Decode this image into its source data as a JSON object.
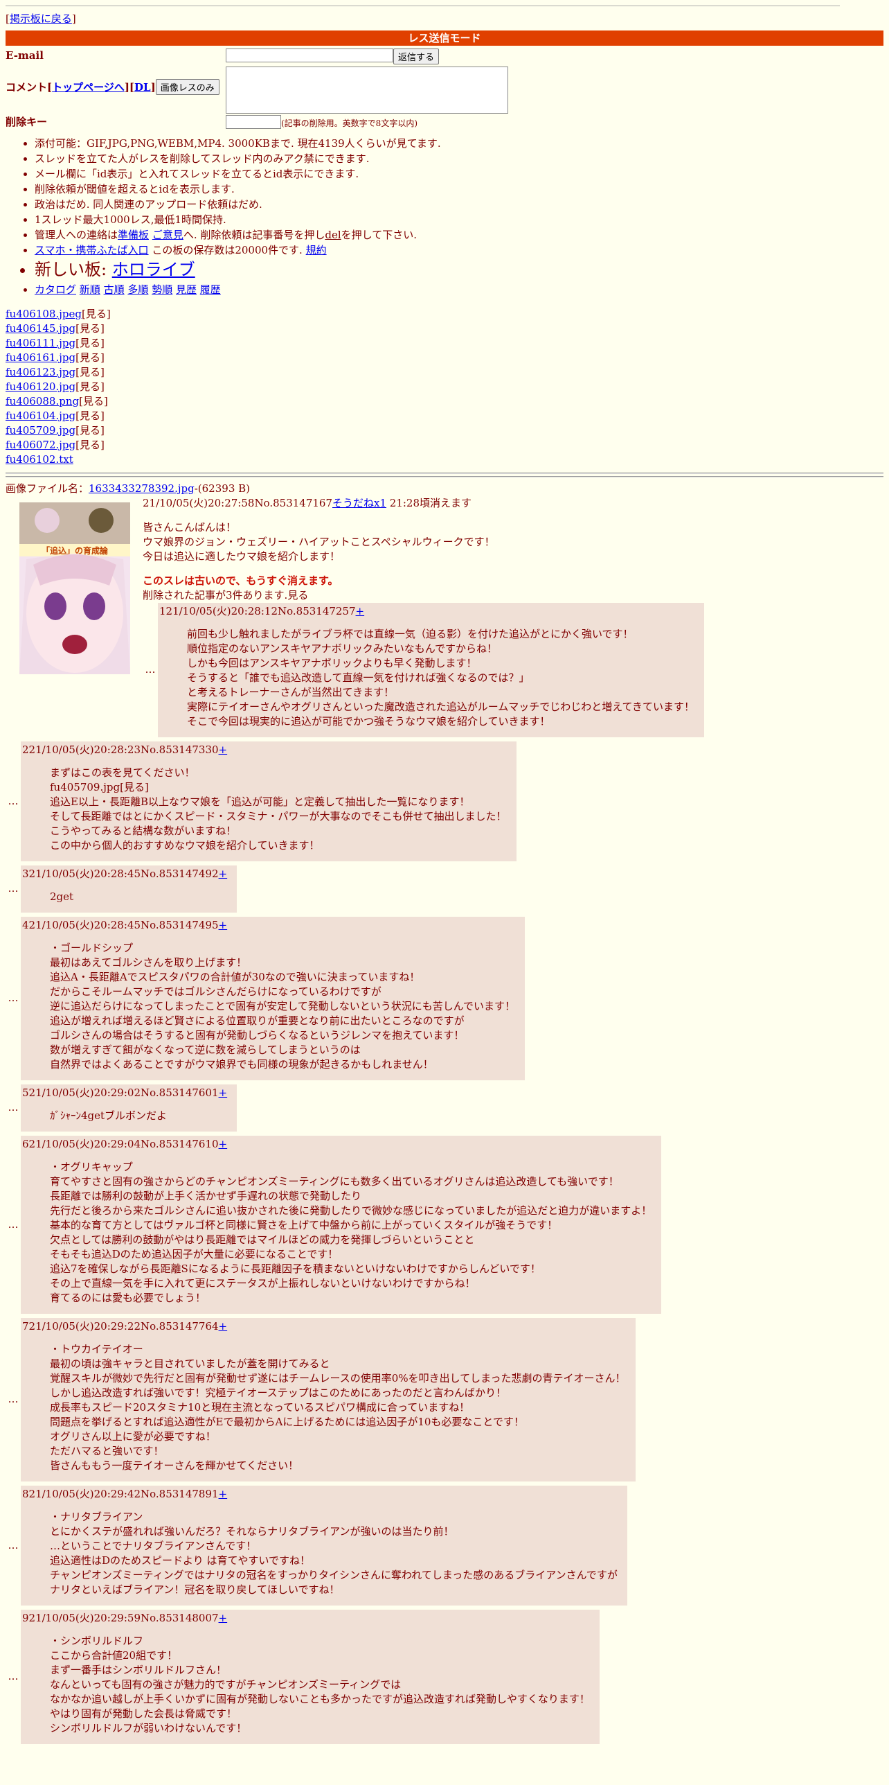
{
  "nav": {
    "back": "掲示板に戻る"
  },
  "mode_bar": "レス送信モード",
  "form": {
    "email_label": "E-mail",
    "submit": "返信する",
    "comment_label": "コメント",
    "top_link": "トップページへ",
    "dl_link": "DL",
    "image_only_button": "画像レスのみ",
    "delkey_label": "削除キー",
    "delkey_note": "(記事の削除用。英数字で8文字以内)"
  },
  "rules": [
    "添付可能：GIF,JPG,PNG,WEBM,MP4. 3000KBまで. 現在4139人くらいが見てます.",
    "スレッドを立てた人がレスを削除してスレッド内のみアク禁にできます.",
    "メール欄に「id表示」と入れてスレッドを立てるとid表示にできます.",
    "削除依頼が閾値を超えるとidを表示します.",
    "政治はだめ. 同人関連のアップロード依頼はだめ.",
    "1スレッド最大1000レス,最低1時間保持."
  ],
  "rule_contact": {
    "pre": "管理人への連絡は",
    "link1": "準備板",
    "sep": " ",
    "link2": "ご意見",
    "mid": "へ. 削除依頼は記事番号を押し",
    "del": "del",
    "post": "を押して下さい."
  },
  "rule_mobile": {
    "link": "スマホ・携帯ふたば入口",
    "text": " この板の保存数は20000件です. ",
    "kiyaku": "規約"
  },
  "new_board": {
    "label": "新しい板: ",
    "link": "ホロライブ"
  },
  "catalog_links": [
    "カタログ",
    "新順",
    "古順",
    "多順",
    "勢順",
    "見歴",
    "履歴"
  ],
  "files": [
    {
      "name": "fu406108.jpeg",
      "view": "[見る]"
    },
    {
      "name": "fu406145.jpg",
      "view": "[見る]"
    },
    {
      "name": "fu406111.jpg",
      "view": "[見る]"
    },
    {
      "name": "fu406161.jpg",
      "view": "[見る]"
    },
    {
      "name": "fu406123.jpg",
      "view": "[見る]"
    },
    {
      "name": "fu406120.jpg",
      "view": "[見る]"
    },
    {
      "name": "fu406088.png",
      "view": "[見る]"
    },
    {
      "name": "fu406104.jpg",
      "view": "[見る]"
    },
    {
      "name": "fu405709.jpg",
      "view": "[見る]"
    },
    {
      "name": "fu406072.jpg",
      "view": "[見る]"
    },
    {
      "name": "fu406102.txt",
      "view": ""
    }
  ],
  "op": {
    "file_label": "画像ファイル名：",
    "file_name": "1633433278392.jpg",
    "file_size": "-(62393 B)",
    "header": "21/10/05(火)20:27:58No.853147167",
    "sodane": "そうだねx1",
    "expire": " 21:28頃消えます",
    "thumb_banner": "「追込」の育成論",
    "lines": [
      "皆さんこんばんは！",
      "ウマ娘界のジョン・ウェズリー・ハイアットことスペシャルウィークです！",
      "今日は追込に適したウマ娘を紹介します！"
    ],
    "old_warning": "このスレは古いので、もうすぐ消えます。",
    "deleted_note": "削除された記事が3件あります.見る"
  },
  "replies": [
    {
      "header": "121/10/05(火)20:28:12No.853147257",
      "plus": "+",
      "lines": [
        "前回も少し触れましたがライブラ杯では直線一気（迫る影）を付けた追込がとにかく強いです！",
        "順位指定のないアンスキヤアナボリックみたいなもんですからね！",
        "しかも今回はアンスキヤアナボリックよりも早く発動します！",
        "そうすると「誰でも追込改造して直線一気を付ければ強くなるのでは？」",
        "と考えるトレーナーさんが当然出てきます！",
        "実際にテイオーさんやオグリさんといった魔改造された追込がルームマッチでじわじわと増えてきています！",
        "そこで今回は現実的に追込が可能でかつ強そうなウマ娘を紹介していきます！"
      ]
    },
    {
      "header": "221/10/05(火)20:28:23No.853147330",
      "plus": "+",
      "lines": [
        "まずはこの表を見てください！",
        "fu405709.jpg[見る]",
        "追込E以上・長距離B以上なウマ娘を「追込が可能」と定義して抽出した一覧になります！",
        "そして長距離ではとにかくスピード・スタミナ・パワーが大事なのでそこも併せて抽出しました！",
        "こうやってみると結構な数がいますね！",
        "この中から個人的おすすめなウマ娘を紹介していきます！"
      ]
    },
    {
      "header": "321/10/05(火)20:28:45No.853147492",
      "plus": "+",
      "lines": [
        "2get"
      ]
    },
    {
      "header": "421/10/05(火)20:28:45No.853147495",
      "plus": "+",
      "lines": [
        "・ゴールドシップ",
        "最初はあえてゴルシさんを取り上げます！",
        "追込A・長距離Aでスピスタパワの合計値が30なので強いに決まっていますね！",
        "だからこそルームマッチではゴルシさんだらけになっているわけですが",
        "逆に追込だらけになってしまったことで固有が安定して発動しないという状況にも苦しんでいます！",
        "追込が増えれば増えるほど賢さによる位置取りが重要となり前に出たいところなのですが",
        "ゴルシさんの場合はそうすると固有が発動しづらくなるというジレンマを抱えています！",
        "数が増えすぎて餌がなくなって逆に数を減らしてしまうというのは",
        "自然界ではよくあることですがウマ娘界でも同様の現象が起きるかもしれません！"
      ]
    },
    {
      "header": "521/10/05(火)20:29:02No.853147601",
      "plus": "+",
      "lines": [
        "ｶﾞｼｬｰﾝ4getブルボンだよ"
      ]
    },
    {
      "header": "621/10/05(火)20:29:04No.853147610",
      "plus": "+",
      "lines": [
        "・オグリキャップ",
        "育てやすさと固有の強さからどのチャンピオンズミーティングにも数多く出ているオグリさんは追込改造しても強いです！",
        "長距離では勝利の鼓動が上手く活かせず手遅れの状態で発動したり",
        "先行だと後ろから来たゴルシさんに追い抜かされた後に発動したりで微妙な感じになっていましたが追込だと迫力が違いますよ！",
        "基本的な育て方としてはヴァルゴ杯と同様に賢さを上げて中盤から前に上がっていくスタイルが強そうです！",
        "欠点としては勝利の鼓動がやはり長距離ではマイルほどの威力を発揮しづらいということと",
        "そもそも追込Dのため追込因子が大量に必要になることです！",
        "追込7を確保しながら長距離Sになるように長距離因子を積まないといけないわけですからしんどいです！",
        "その上で直線一気を手に入れて更にステータスが上振れしないといけないわけですからね！",
        "育てるのには愛も必要でしょう！"
      ]
    },
    {
      "header": "721/10/05(火)20:29:22No.853147764",
      "plus": "+",
      "lines": [
        "・トウカイテイオー",
        "最初の頃は強キャラと目されていましたが蓋を開けてみると",
        "覚醒スキルが微妙で先行だと固有が発動せず遂にはチームレースの使用率0%を叩き出してしまった悲劇の青テイオーさん！",
        "しかし追込改造すれば強いです！究極テイオーステップはこのためにあったのだと言わんばかり！",
        "成長率もスピード20スタミナ10と現在主流となっているスピパワ構成に合っていますね！",
        "問題点を挙げるとすれば追込適性がEで最初からAに上げるためには追込因子が10も必要なことです！",
        "オグリさん以上に愛が必要ですね！",
        "ただハマると強いです！",
        "皆さんももう一度テイオーさんを輝かせてください！"
      ]
    },
    {
      "header": "821/10/05(火)20:29:42No.853147891",
      "plus": "+",
      "lines": [
        "・ナリタブライアン",
        "とにかくステが盛れれば強いんだろ？それならナリタブライアンが強いのは当たり前！",
        "…ということでナリタブライアンさんです！",
        "追込適性はDのためスピードより は育てやすいですね！",
        "チャンピオンズミーティングではナリタの冠名をすっかりタイシンさんに奪われてしまった感のあるブライアンさんですが",
        "ナリタといえばブライアン！冠名を取り戻してほしいですね！"
      ]
    },
    {
      "header": "921/10/05(火)20:29:59No.853148007",
      "plus": "+",
      "lines": [
        "・シンボリルドルフ",
        "ここから合計値20組です！",
        "まず一番手はシンボリルドルフさん！",
        "なんといっても固有の強さが魅力的ですがチャンピオンズミーティングでは",
        "なかなか追い越しが上手くいかずに固有が発動しないことも多かったですが追込改造すれば発動しやすくなります！",
        "やはり固有が発動した会長は脅威です！",
        "シンボリルドルフが弱いわけないんです！"
      ]
    }
  ]
}
